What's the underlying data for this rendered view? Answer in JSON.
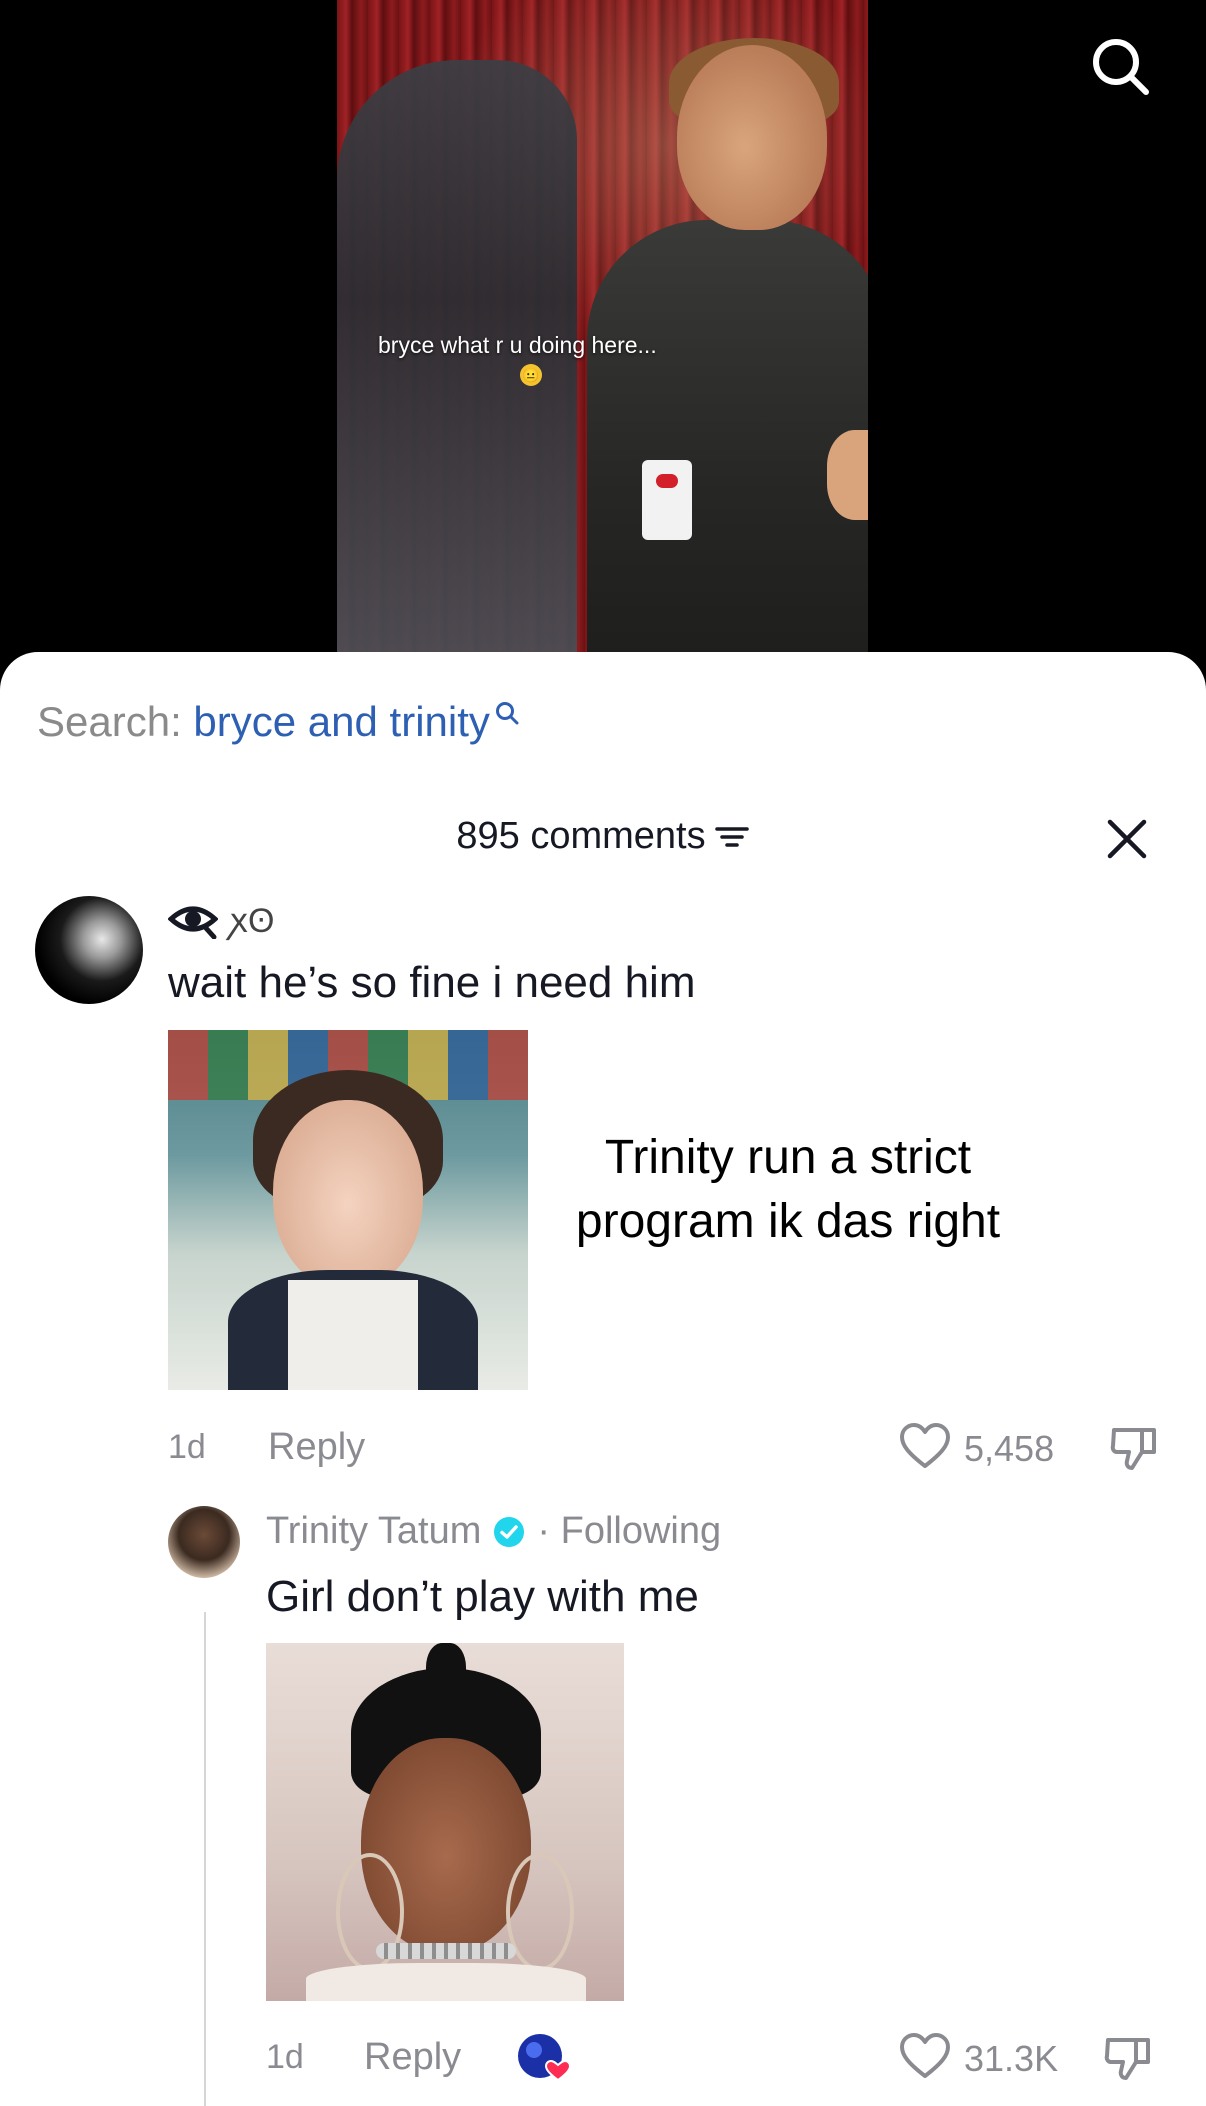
{
  "video": {
    "caption": "bryce what r u doing here...",
    "caption_emoji": "😐"
  },
  "search": {
    "prefix": "Search:",
    "term": "bryce and trinity"
  },
  "comments": {
    "count_label": "895 comments"
  },
  "comment_1": {
    "username": "ꭗʘ",
    "text": "wait he’s so fine i need him",
    "quote_text": "Trinity run a strict program ik das right",
    "time": "1d",
    "reply_label": "Reply",
    "like_count": "5,458"
  },
  "reply_1": {
    "username": "Trinity Tatum",
    "following_label": "· Following",
    "text": "Girl don’t play with me",
    "time": "1d",
    "reply_label": "Reply",
    "like_count": "31.3K"
  },
  "colors": {
    "search_term": "#2d5fb3",
    "verified": "#20d5ec",
    "creator_heart": "#fe2c55"
  }
}
